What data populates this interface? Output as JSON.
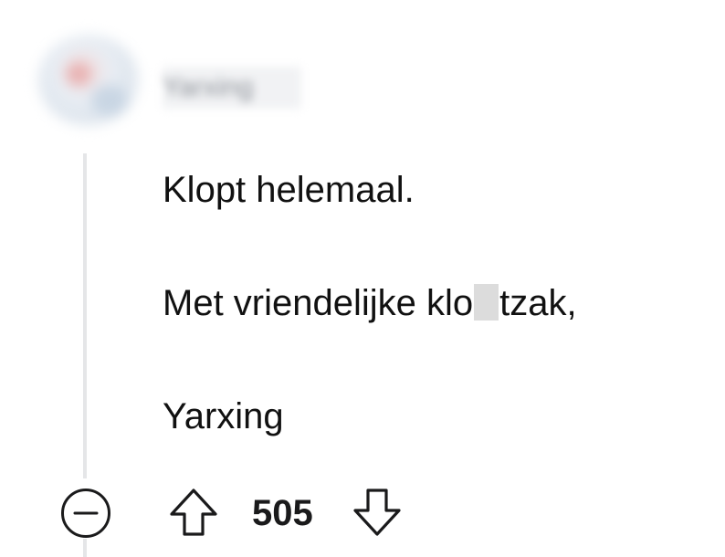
{
  "comment": {
    "author": "Yarxing",
    "lines": [
      "Klopt helemaal.",
      {
        "before": "Met vriendelijke klo",
        "after": "tzak,"
      },
      "Yarxing"
    ]
  },
  "actions": {
    "score": "505",
    "collapse_icon": "minus-circle-icon",
    "upvote_icon": "arrow-up-icon",
    "downvote_icon": "arrow-down-icon"
  },
  "colors": {
    "text": "#1a1a1b",
    "thread_line": "#e5e6e8",
    "censor": "#dcdcdc"
  }
}
